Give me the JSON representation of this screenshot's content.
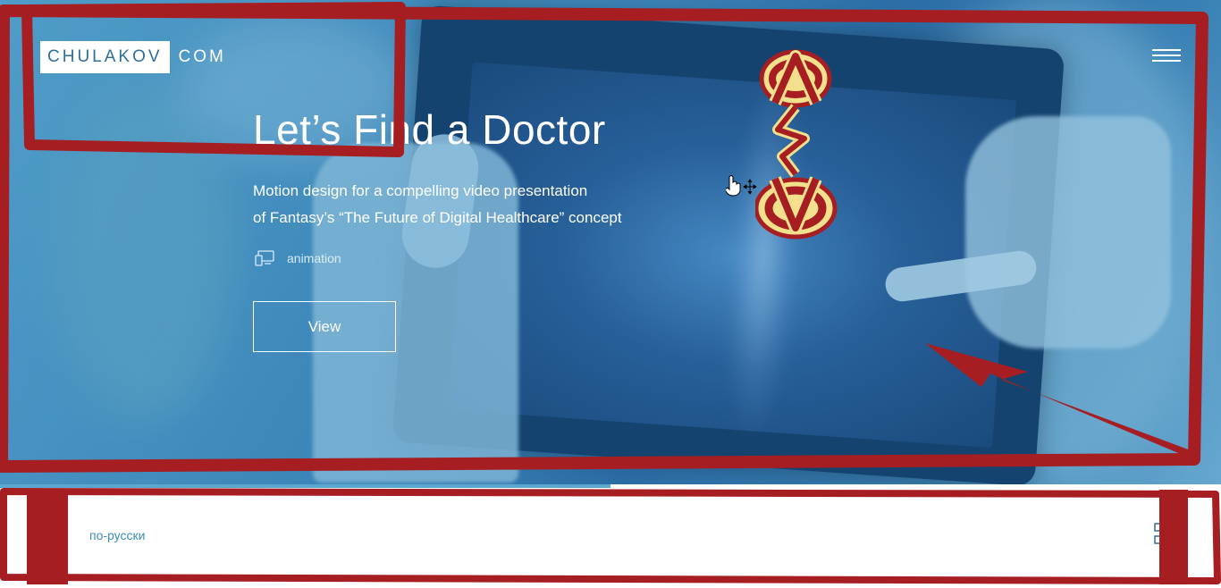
{
  "header": {
    "logo_box": "CHULAKOV",
    "logo_suffix": "COM",
    "menu_icon": "hamburger-icon"
  },
  "hero": {
    "headline": "Let’s Find a Doctor",
    "subtitle_lines": [
      "Motion design for a compelling video presentation",
      "of Fantasy’s “The Future of Digital Healthcare” concept"
    ],
    "category_icon": "monitor-devices-icon",
    "category_label": "animation",
    "cta_label": "View"
  },
  "footer": {
    "language_link": "по-русски",
    "grid_icon": "grid-icon"
  },
  "annotation": {
    "badge_icon": "badge-logo-icon",
    "frame_color": "#a61e22",
    "badge_fill": "#f2e08c"
  },
  "colors": {
    "hero_blue": "#3f86b7",
    "link_blue": "#3b8dbd",
    "logo_text": "#2d6f9c"
  }
}
